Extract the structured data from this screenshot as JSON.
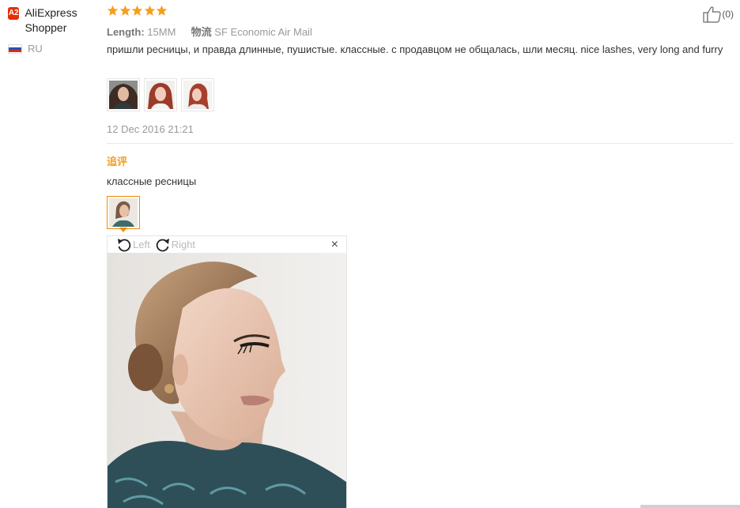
{
  "user": {
    "badge": "A2",
    "name": "AliExpress Shopper",
    "country": "RU",
    "flag_colors": [
      "#ffffff",
      "#1c57b8",
      "#d52b1e"
    ]
  },
  "review": {
    "rating": 5,
    "star_color": "#f79e1b",
    "length_label": "Length:",
    "length_value": "15MM",
    "shipping_label": "物流",
    "shipping_value": "SF Economic Air Mail",
    "helpful_count": "(0)",
    "text": "пришли ресницы, и правда длинные, пушистые. классные. с продавцом не общалась, шли месяц. nice lashes, very long and furry",
    "photo_count": 3,
    "date": "12 Dec 2016 21:21"
  },
  "followup": {
    "title": "追评",
    "text": "классные ресницы",
    "photo_count": 1
  },
  "viewer": {
    "rotate_left": "Left",
    "rotate_right": "Right",
    "close_icon": "×"
  },
  "colors": {
    "accent": "#f79e1b",
    "badge": "#e62e04",
    "thumb_active_border": "#f28a00"
  }
}
